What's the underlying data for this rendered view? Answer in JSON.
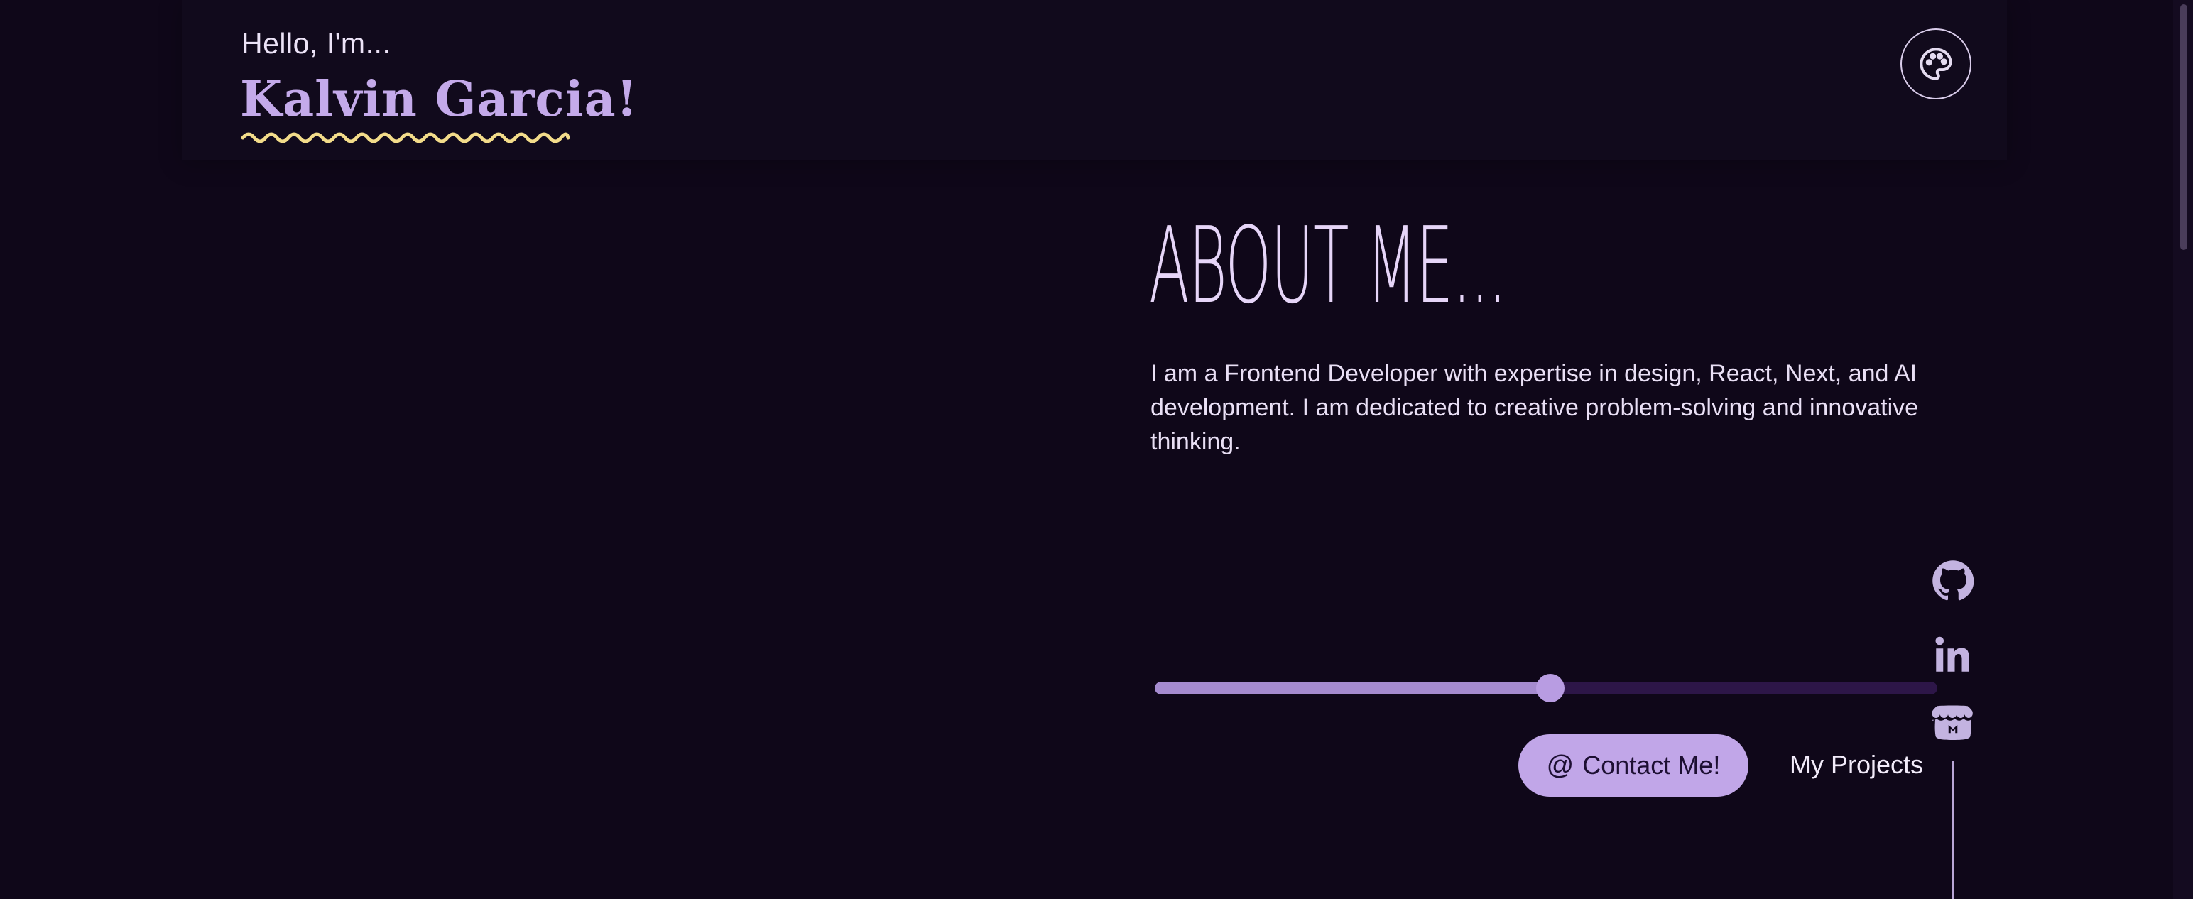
{
  "header": {
    "greeting": "Hello, I'm...",
    "name": "Kalvin Garcia!"
  },
  "theme_button": {
    "icon": "palette-icon"
  },
  "about": {
    "title": "ABOUT ME...",
    "text": "I am a Frontend Developer with expertise in design, React, Next, and AI development. I am dedicated to creative problem-solving and innovative thinking."
  },
  "slider": {
    "value_fraction": 0.505
  },
  "actions": {
    "contact_icon": "@",
    "contact_label": "Contact Me!",
    "projects_label": "My Projects"
  },
  "social": [
    {
      "icon": "github-icon"
    },
    {
      "icon": "linkedin-icon"
    },
    {
      "icon": "itchio-icon"
    }
  ],
  "colors": {
    "background": "#0f0719",
    "accent": "#c1a6e8",
    "name": "#c4aaea",
    "squiggle": "#f3dc8a",
    "slider_track": "#2d1648",
    "slider_fill": "#a58bcf"
  }
}
